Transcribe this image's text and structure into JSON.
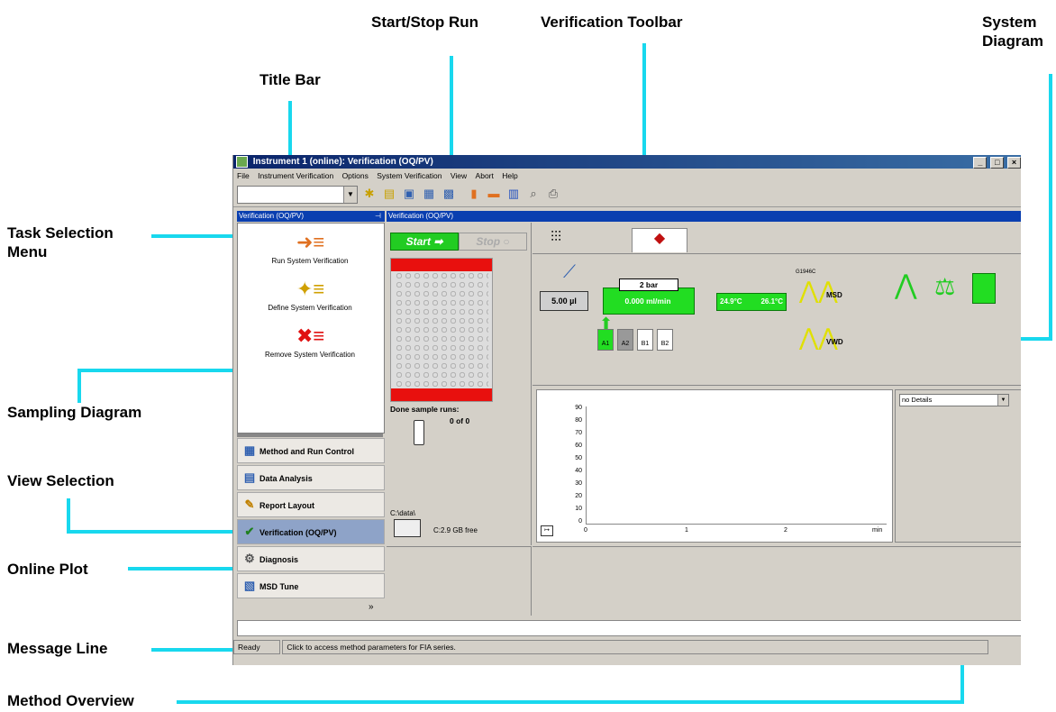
{
  "callouts": {
    "start_stop": "Start/Stop Run",
    "verification_toolbar": "Verification Toolbar",
    "system_diagram_1": "System",
    "system_diagram_2": "Diagram",
    "title_bar": "Title Bar",
    "task_selection_1": "Task Selection",
    "task_selection_2": "Menu",
    "sampling_diagram": "Sampling Diagram",
    "view_selection": "View Selection",
    "online_plot": "Online Plot",
    "message_line": "Message Line",
    "method_overview": "Method Overview"
  },
  "window": {
    "title": "Instrument 1 (online): Verification (OQ/PV)",
    "controls": [
      "_",
      "□",
      "×"
    ]
  },
  "menu": [
    "File",
    "Instrument Verification",
    "Options",
    "System Verification",
    "View",
    "Abort",
    "Help"
  ],
  "toolbar": {
    "combo_value": "",
    "icons": [
      "define-icon",
      "load-icon",
      "save-icon",
      "save-as-icon",
      "print-setup-icon",
      "report-icon",
      "book-icon",
      "chart-icon",
      "preview-icon",
      "print-icon"
    ]
  },
  "left_panel": {
    "title": "Verification (OQ/PV)",
    "pin": "⊣",
    "tasks": [
      {
        "label": "Run System Verification",
        "icon": "run-verification-icon"
      },
      {
        "label": "Define System Verification",
        "icon": "define-verification-icon"
      },
      {
        "label": "Remove System Verification",
        "icon": "remove-verification-icon"
      }
    ],
    "views": [
      {
        "label": "Method and Run Control",
        "icon": "method-run-icon"
      },
      {
        "label": "Data Analysis",
        "icon": "data-analysis-icon"
      },
      {
        "label": "Report Layout",
        "icon": "report-layout-icon"
      },
      {
        "label": "Verification (OQ/PV)",
        "icon": "verification-icon"
      },
      {
        "label": "Diagnosis",
        "icon": "diagnosis-icon"
      },
      {
        "label": "MSD Tune",
        "icon": "msd-tune-icon"
      }
    ]
  },
  "main_panel": {
    "title": "Verification (OQ/PV)",
    "start_label": "Start",
    "stop_label": "Stop",
    "done_runs_label": "Done sample runs:",
    "done_runs_value": "0 of 0",
    "data_path": "C:\\data\\",
    "disk_free": "C:2.9 GB free"
  },
  "system": {
    "injector_volume": "5.00 µl",
    "pump_pressure": "2 bar",
    "pump_flow": "0.000 ml/min",
    "column_temp_left": "24.9°C",
    "column_temp_right": "26.1°C",
    "msd_model": "G1946C",
    "msd_label": "MSD",
    "vwd_label": "VWD",
    "bottles": [
      "A1",
      "A2",
      "B1",
      "B2"
    ]
  },
  "plot": {
    "y_ticks": [
      "90",
      "80",
      "70",
      "60",
      "50",
      "40",
      "30",
      "20",
      "10",
      "0"
    ],
    "x_ticks": [
      "0",
      "1",
      "2"
    ],
    "x_unit": "min"
  },
  "details": {
    "dropdown_value": "no Details"
  },
  "statusbar": {
    "state": "Ready",
    "message": "Click to access method parameters for FIA series."
  },
  "colors": {
    "callout_line": "#18d8ee",
    "title_bar": "#0a246a",
    "panel_title": "#0a3fb0",
    "device_green": "#22dd22",
    "tray_red": "#e8100e"
  }
}
